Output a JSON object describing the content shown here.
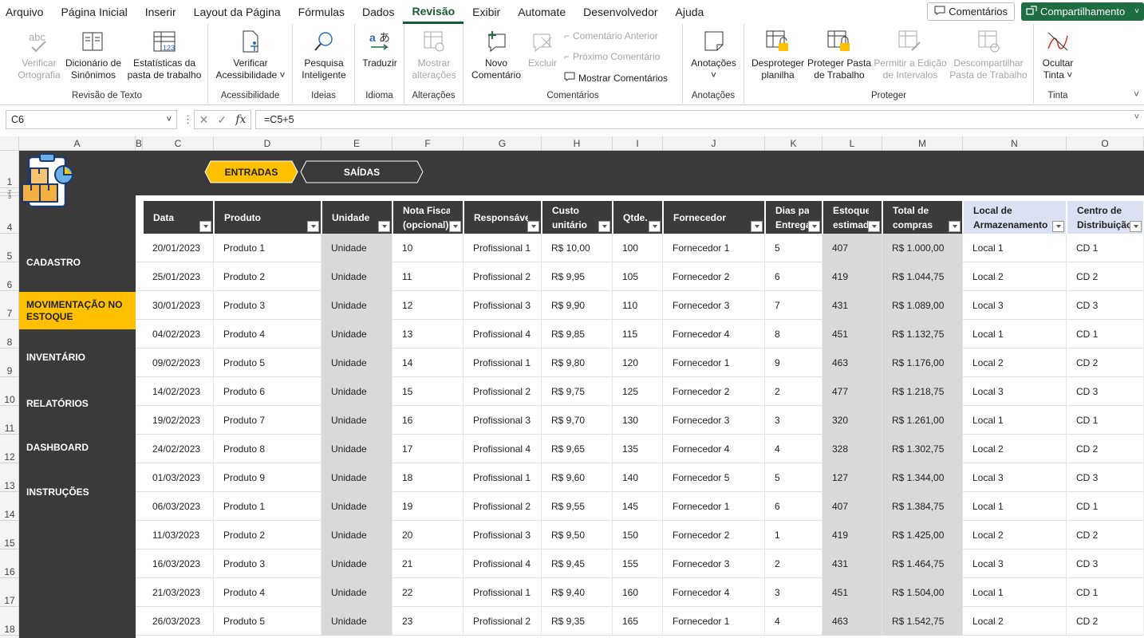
{
  "menu": [
    "Arquivo",
    "Página Inicial",
    "Inserir",
    "Layout da Página",
    "Fórmulas",
    "Dados",
    "Revisão",
    "Exibir",
    "Automate",
    "Desenvolvedor",
    "Ajuda"
  ],
  "menu_active": "Revisão",
  "top_buttons": {
    "comments": "Comentários",
    "share": "Compartilhamento"
  },
  "ribbon": {
    "groups": {
      "revisao_texto": "Revisão de Texto",
      "acessibilidade": "Acessibilidade",
      "ideias": "Ideias",
      "idioma": "Idioma",
      "alteracoes": "Alterações",
      "comentarios": "Comentários",
      "anotacoes": "Anotações",
      "proteger": "Proteger",
      "tinta": "Tinta"
    },
    "buttons": {
      "ortografia": [
        "Verificar",
        "Ortografia"
      ],
      "sinonimos": [
        "Dicionário de",
        "Sinônimos"
      ],
      "estatisticas": [
        "Estatísticas da",
        "pasta de trabalho"
      ],
      "acessibilidade": [
        "Verificar",
        "Acessibilidade ˅"
      ],
      "pesquisa": [
        "Pesquisa",
        "Inteligente"
      ],
      "traduzir": [
        "Traduzir"
      ],
      "mostrar_alt": [
        "Mostrar",
        "alterações"
      ],
      "novo_coment": [
        "Novo",
        "Comentário"
      ],
      "excluir": [
        "Excluir"
      ],
      "coment_anterior": "Comentário Anterior",
      "proximo_coment": "Próximo Comentário",
      "mostrar_coment": "Mostrar Comentários",
      "anotacoes": [
        "Anotações",
        "˅"
      ],
      "desproteger": [
        "Desproteger",
        "planilha"
      ],
      "proteger_pasta": [
        "Proteger Pasta",
        "de Trabalho"
      ],
      "permitir": [
        "Permitir a Edição",
        "de Intervalos"
      ],
      "descompartilhar": [
        "Descompartilhar",
        "Pasta de Trabalho"
      ],
      "ocultar": [
        "Ocultar",
        "Tinta ˅"
      ]
    }
  },
  "formula_bar": {
    "name_box": "C6",
    "formula": "=C5+5"
  },
  "columns": [
    "A",
    "B",
    "C",
    "D",
    "E",
    "F",
    "G",
    "H",
    "I",
    "J",
    "K",
    "L",
    "M",
    "N",
    "O"
  ],
  "rows": [
    "1",
    "2",
    "3",
    "4",
    "5",
    "6",
    "7",
    "8",
    "9",
    "10",
    "11",
    "12",
    "13",
    "14",
    "15",
    "16",
    "17",
    "18"
  ],
  "nav": [
    "CADASTRO",
    "MOVIMENTAÇÃO NO ESTOQUE",
    "INVENTÁRIO",
    "RELATÓRIOS",
    "DASHBOARD",
    "INSTRUÇÕES"
  ],
  "nav_active": "MOVIMENTAÇÃO NO ESTOQUE",
  "tabs": {
    "entradas": "ENTRADAS",
    "saidas": "SAÍDAS"
  },
  "headers": [
    [
      "Data"
    ],
    [
      "Produto"
    ],
    [
      "Unidade"
    ],
    [
      "Nota Fiscal",
      "(opcional)"
    ],
    [
      "Responsável"
    ],
    [
      "Custo",
      "unitário"
    ],
    [
      "Qtde."
    ],
    [
      "Fornecedor"
    ],
    [
      "Dias para",
      "Entrega"
    ],
    [
      "Estoque",
      "estimado"
    ],
    [
      "Total de",
      "compras"
    ],
    [
      "Local de",
      "Armazenamento"
    ],
    [
      "Centro de",
      "Distribuição"
    ]
  ],
  "table": [
    [
      "20/01/2023",
      "Produto 1",
      "Unidade",
      "10",
      "Profissional 1",
      "R$ 10,00",
      "100",
      "Fornecedor 1",
      "5",
      "407",
      "R$ 1.000,00",
      "Local 1",
      "CD 1"
    ],
    [
      "25/01/2023",
      "Produto 2",
      "Unidade",
      "11",
      "Profissional 2",
      "R$ 9,95",
      "105",
      "Fornecedor 2",
      "6",
      "419",
      "R$ 1.044,75",
      "Local 2",
      "CD 2"
    ],
    [
      "30/01/2023",
      "Produto 3",
      "Unidade",
      "12",
      "Profissional 3",
      "R$ 9,90",
      "110",
      "Fornecedor 3",
      "7",
      "431",
      "R$ 1.089,00",
      "Local 3",
      "CD 3"
    ],
    [
      "04/02/2023",
      "Produto 4",
      "Unidade",
      "13",
      "Profissional 4",
      "R$ 9,85",
      "115",
      "Fornecedor 4",
      "8",
      "451",
      "R$ 1.132,75",
      "Local 1",
      "CD 1"
    ],
    [
      "09/02/2023",
      "Produto 5",
      "Unidade",
      "14",
      "Profissional 1",
      "R$ 9,80",
      "120",
      "Fornecedor 1",
      "9",
      "463",
      "R$ 1.176,00",
      "Local 2",
      "CD 2"
    ],
    [
      "14/02/2023",
      "Produto 6",
      "Unidade",
      "15",
      "Profissional 2",
      "R$ 9,75",
      "125",
      "Fornecedor 2",
      "2",
      "477",
      "R$ 1.218,75",
      "Local 3",
      "CD 3"
    ],
    [
      "19/02/2023",
      "Produto 7",
      "Unidade",
      "16",
      "Profissional 3",
      "R$ 9,70",
      "130",
      "Fornecedor 3",
      "3",
      "320",
      "R$ 1.261,00",
      "Local 1",
      "CD 1"
    ],
    [
      "24/02/2023",
      "Produto 8",
      "Unidade",
      "17",
      "Profissional 4",
      "R$ 9,65",
      "135",
      "Fornecedor 4",
      "4",
      "328",
      "R$ 1.302,75",
      "Local 2",
      "CD 2"
    ],
    [
      "01/03/2023",
      "Produto 9",
      "Unidade",
      "18",
      "Profissional 1",
      "R$ 9,60",
      "140",
      "Fornecedor 5",
      "5",
      "127",
      "R$ 1.344,00",
      "Local 3",
      "CD 3"
    ],
    [
      "06/03/2023",
      "Produto 1",
      "Unidade",
      "19",
      "Profissional 2",
      "R$ 9,55",
      "145",
      "Fornecedor 1",
      "6",
      "407",
      "R$ 1.384,75",
      "Local 1",
      "CD 1"
    ],
    [
      "11/03/2023",
      "Produto 2",
      "Unidade",
      "20",
      "Profissional 3",
      "R$ 9,50",
      "150",
      "Fornecedor 2",
      "1",
      "419",
      "R$ 1.425,00",
      "Local 2",
      "CD 2"
    ],
    [
      "16/03/2023",
      "Produto 3",
      "Unidade",
      "21",
      "Profissional 4",
      "R$ 9,45",
      "155",
      "Fornecedor 3",
      "2",
      "431",
      "R$ 1.464,75",
      "Local 3",
      "CD 3"
    ],
    [
      "21/03/2023",
      "Produto 4",
      "Unidade",
      "22",
      "Profissional 1",
      "R$ 9,40",
      "160",
      "Fornecedor 4",
      "3",
      "451",
      "R$ 1.504,00",
      "Local 1",
      "CD 1"
    ],
    [
      "26/03/2023",
      "Produto 5",
      "Unidade",
      "23",
      "Profissional 2",
      "R$ 9,35",
      "165",
      "Fornecedor 1",
      "4",
      "463",
      "R$ 1.542,75",
      "Local 2",
      "CD 2"
    ]
  ],
  "colors": {
    "accent": "#ffc000",
    "dark": "#3a3a3a",
    "excel_green": "#1f6e43",
    "blue_header": "#d9e1f2",
    "gray_cell": "#d9d9d9"
  }
}
